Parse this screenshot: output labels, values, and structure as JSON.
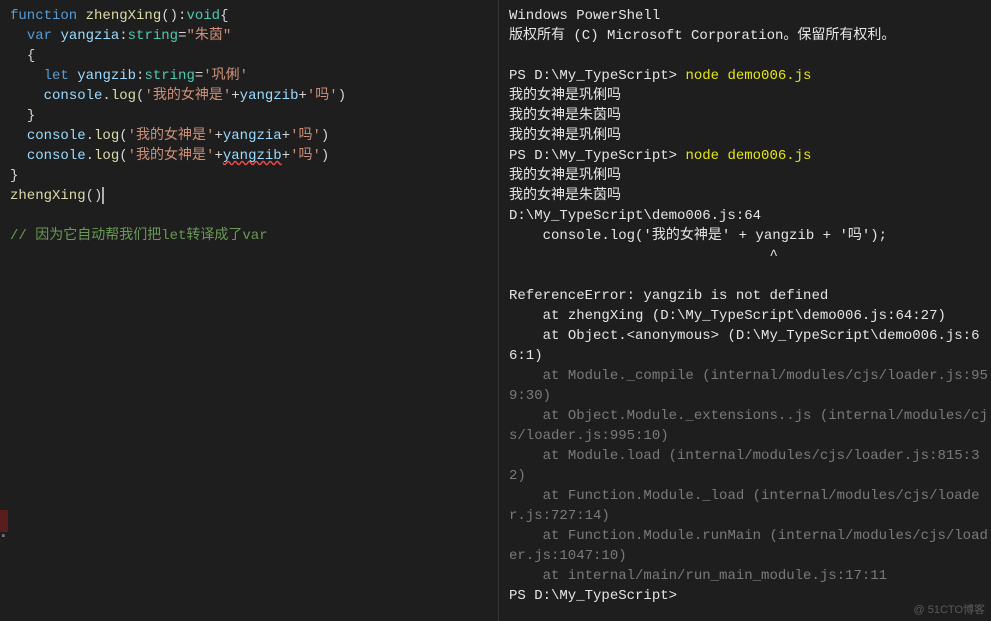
{
  "editor": {
    "code": {
      "l1": {
        "fn_kw": "function",
        "name": "zhengXing",
        "ret": "void"
      },
      "l2": {
        "var_kw": "var",
        "name": "yangzia",
        "type": "string",
        "val": "\"朱茵\""
      },
      "l3": {
        "brace": "{"
      },
      "l4": {
        "let_kw": "let",
        "name": "yangzib",
        "type": "string",
        "val": "'巩俐'"
      },
      "l5": {
        "obj": "console",
        "fn": "log",
        "str1": "'我的女神是'",
        "id": "yangzib",
        "str2": "'吗'"
      },
      "l6": {
        "brace": "}"
      },
      "l7": {
        "obj": "console",
        "fn": "log",
        "str1": "'我的女神是'",
        "id": "yangzia",
        "str2": "'吗'"
      },
      "l8": {
        "obj": "console",
        "fn": "log",
        "str1": "'我的女神是'",
        "id": "yangzib",
        "str2": "'吗'"
      },
      "l9": {
        "brace": "}"
      },
      "l10": {
        "call": "zhengXing"
      },
      "comment": "// 因为它自动帮我们把let转译成了var"
    }
  },
  "terminal": {
    "header1": "Windows PowerShell",
    "header2": "版权所有 (C) Microsoft Corporation。保留所有权利。",
    "ps1_prompt": "PS D:\\My_TypeScript>",
    "cmd1": "node demo006.js",
    "out1": "我的女神是巩俐吗",
    "out2": "我的女神是朱茵吗",
    "out3": "我的女神是巩俐吗",
    "cmd2": "node demo006.js",
    "out4": "我的女神是巩俐吗",
    "out5": "我的女神是朱茵吗",
    "err_file": "D:\\My_TypeScript\\demo006.js:64",
    "err_code": "    console.log('我的女神是' + yangzib + '吗');",
    "err_caret": "                               ^",
    "err_head": "ReferenceError: yangzib is not defined",
    "stack": [
      "    at zhengXing (D:\\My_TypeScript\\demo006.js:64:27)",
      "    at Object.<anonymous> (D:\\My_TypeScript\\demo006.js:66:1)",
      "    at Module._compile (internal/modules/cjs/loader.js:959:30)",
      "    at Object.Module._extensions..js (internal/modules/cjs/loader.js:995:10)",
      "    at Module.load (internal/modules/cjs/loader.js:815:32)",
      "    at Function.Module._load (internal/modules/cjs/loader.js:727:14)",
      "    at Function.Module.runMain (internal/modules/cjs/loader.js:1047:10)",
      "    at internal/main/run_main_module.js:17:11"
    ],
    "ps_end": "PS D:\\My_TypeScript> "
  },
  "watermark": "@ 51CTO博客"
}
